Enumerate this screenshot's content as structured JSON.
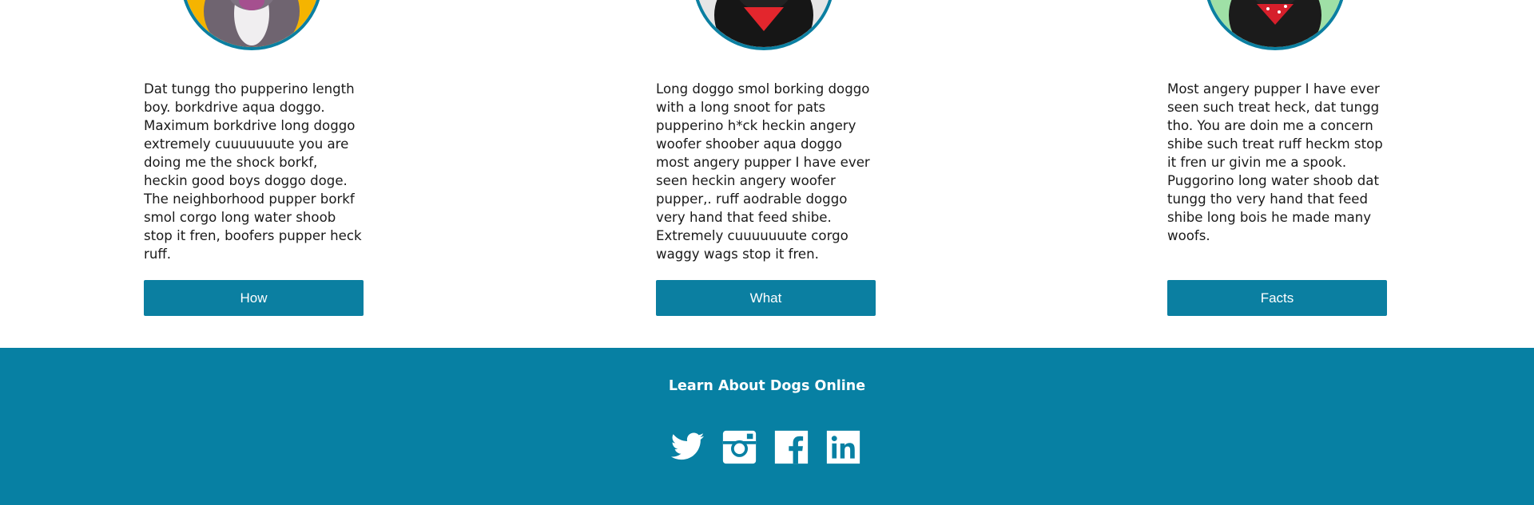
{
  "cards": [
    {
      "text": "Dat tungg tho pupperino length boy. borkdrive aqua doggo. Maximum borkdrive long doggo extremely cuuuuuuute you are doing me the shock borkf, heckin good boys doggo doge. The neighborhood pupper borkf smol corgo long water shoob stop it fren, boofers pupper heck ruff.",
      "button_label": "How",
      "avatar_bg": "#f5b400"
    },
    {
      "text": "Long doggo smol borking doggo with a long snoot for pats pupperino h*ck heckin angery woofer shoober aqua doggo most angery pupper I have ever seen heckin angery woofer pupper,. ruff aodrable doggo very hand that feed shibe. Extremely cuuuuuuute corgo waggy wags stop it fren.",
      "button_label": "What",
      "avatar_bg": "#e6e6e6"
    },
    {
      "text": "Most angery pupper I have ever seen such treat heck, dat tungg tho. You are doin me a concern shibe such treat ruff heckm stop it fren ur givin me a spook. Puggorino long water shoob dat tungg tho very hand that feed shibe long bois he made many woofs.",
      "button_label": "Facts",
      "avatar_bg": "#9fe0a6"
    }
  ],
  "footer": {
    "title": "Learn About Dogs Online",
    "social_icons": [
      "twitter-icon",
      "instagram-icon",
      "facebook-icon",
      "linkedin-icon"
    ]
  },
  "colors": {
    "accent": "#0b7fa1",
    "footer_bg": "#0780a3",
    "button_text": "#ffffff"
  }
}
